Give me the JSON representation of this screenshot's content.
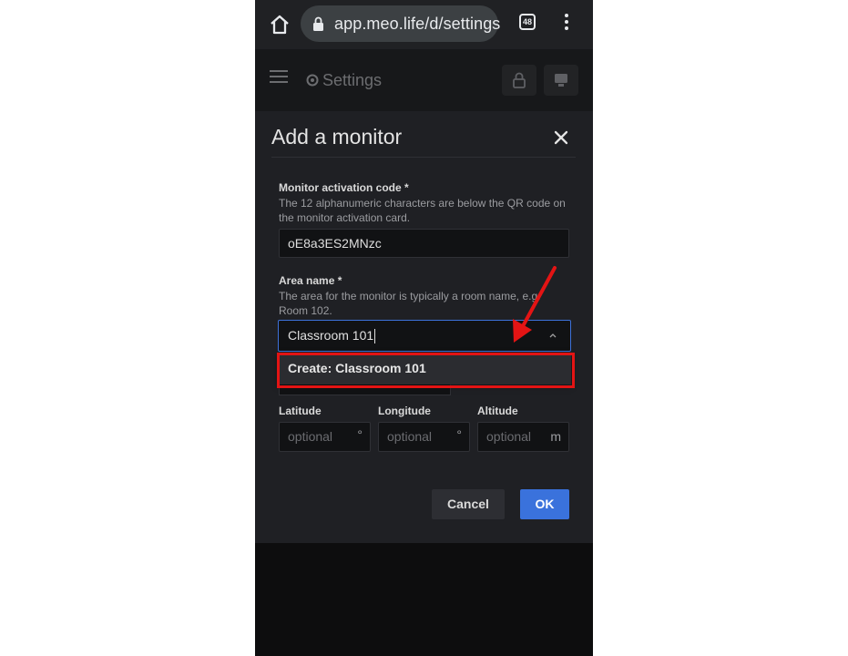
{
  "browser": {
    "url": "app.meo.life/d/settings",
    "tab_count": "48"
  },
  "app_header": {
    "title": "Settings"
  },
  "modal": {
    "title": "Add a monitor",
    "activation": {
      "label": "Monitor activation code *",
      "description": "The 12 alphanumeric characters are below the QR code on the monitor activation card.",
      "value": "oE8a3ES2MNzc"
    },
    "area": {
      "label": "Area name *",
      "description": "The area for the monitor is typically a room name, e.g. Room 102.",
      "value": "Classroom 101",
      "dropdown_option": "Create: Classroom 101"
    },
    "coordinates": {
      "latitude": {
        "label": "Latitude",
        "placeholder": "optional",
        "unit": "°"
      },
      "longitude": {
        "label": "Longitude",
        "placeholder": "optional",
        "unit": "°"
      },
      "altitude": {
        "label": "Altitude",
        "placeholder": "optional",
        "unit": "m"
      }
    },
    "buttons": {
      "cancel": "Cancel",
      "ok": "OK"
    }
  },
  "colors": {
    "accent": "#3a72dc",
    "annotation": "#e31414",
    "modal_bg": "#1f2024"
  }
}
